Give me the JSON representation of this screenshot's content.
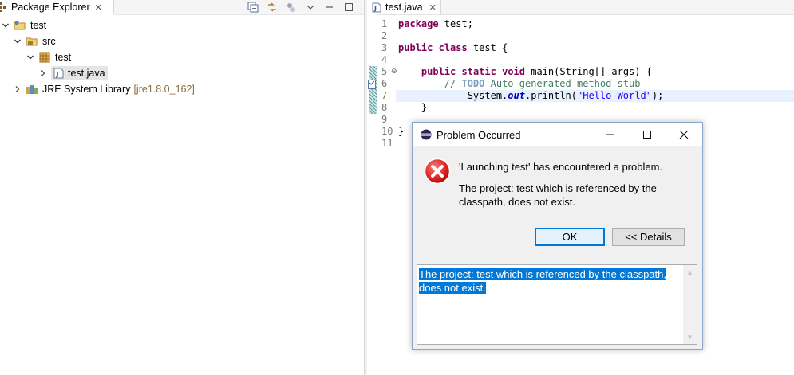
{
  "package_explorer": {
    "tab_label": "Package Explorer",
    "tab_close": "✕",
    "tree": [
      {
        "label": "test",
        "level": 0,
        "expanded": true,
        "icon": "java-project-icon"
      },
      {
        "label": "src",
        "level": 1,
        "expanded": true,
        "icon": "source-folder-icon"
      },
      {
        "label": "test",
        "level": 2,
        "expanded": true,
        "icon": "package-icon"
      },
      {
        "label": "test.java",
        "level": 3,
        "expanded": false,
        "icon": "java-file-icon",
        "selected": true
      },
      {
        "label": "JRE System Library",
        "extra": "[jre1.8.0_162]",
        "level": 0,
        "expanded": false,
        "icon": "library-icon"
      }
    ]
  },
  "editor": {
    "tab_label": "test.java",
    "tab_close": "✕",
    "line_numbers": [
      "1",
      "2",
      "3",
      "4",
      "5",
      "6",
      "7",
      "8",
      "9",
      "10",
      "11"
    ],
    "lines": {
      "l1_kw": "package",
      "l1_rest": " test;",
      "l3_kw1": "public",
      "l3_kw2": "class",
      "l3_rest": " test {",
      "l5_kw1": "public",
      "l5_kw2": "static",
      "l5_kw3": "void",
      "l5_rest": " main(String[] args) {",
      "l6_comment": "// ",
      "l6_todo": "TODO",
      "l6_rest": " Auto-generated method stub",
      "l7_a": "System.",
      "l7_field": "out",
      "l7_b": ".println(",
      "l7_str": "\"Hello World\"",
      "l7_c": ");",
      "l8": "}",
      "l10": "}"
    }
  },
  "dialog": {
    "title": "Problem Occurred",
    "minimize": "—",
    "maximize": "☐",
    "close": "✕",
    "message": "'Launching test' has encountered a problem.",
    "detail_message": "The project: test which is referenced by the classpath, does not exist.",
    "ok_label": "OK",
    "details_label": "<< Details",
    "details_text": "The project: test which is referenced by the classpath, does not exist."
  }
}
